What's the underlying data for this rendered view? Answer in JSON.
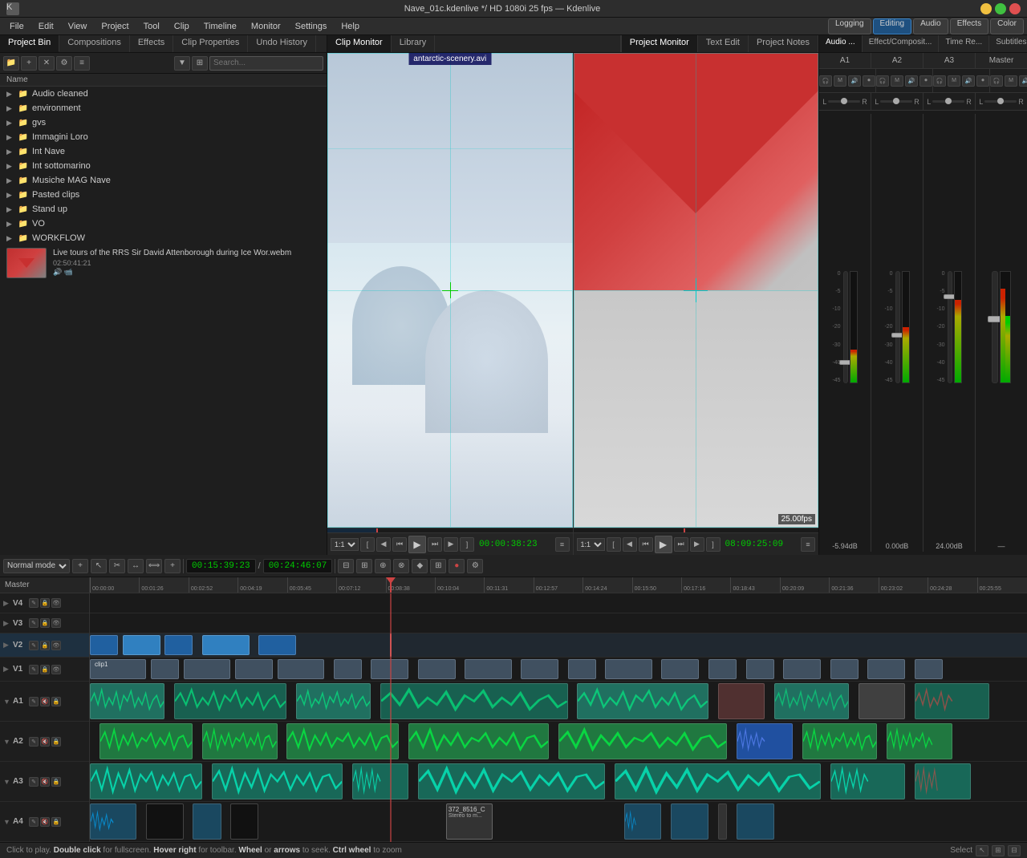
{
  "app": {
    "title": "Nave_01c.kdenlive */  HD 1080i 25 fps — Kdenlive",
    "icon": "K"
  },
  "titlebar": {
    "title": "Nave_01c.kdenlive */  HD 1080i 25 fps — Kdenlive",
    "minimize_label": "─",
    "maximize_label": "□",
    "close_label": "✕"
  },
  "menubar": {
    "items": [
      "File",
      "Edit",
      "View",
      "Project",
      "Tool",
      "Clip",
      "Timeline",
      "Monitor",
      "Settings",
      "Help"
    ]
  },
  "top_toolbar": {
    "logging_label": "Logging",
    "editing_label": "Editing",
    "audio_label": "Audio",
    "effects_label": "Effects",
    "color_label": "Color"
  },
  "left_panel": {
    "tabs": [
      "Project Bin",
      "Compositions",
      "Effects",
      "Clip Properties",
      "Undo History"
    ],
    "active_tab": "Project Bin"
  },
  "bin_toolbar": {
    "search_placeholder": "Search..."
  },
  "file_list": {
    "header": "Name",
    "items": [
      {
        "name": "Audio cleaned",
        "type": "folder",
        "expanded": false
      },
      {
        "name": "environment",
        "type": "folder",
        "expanded": false
      },
      {
        "name": "gvs",
        "type": "folder",
        "expanded": false
      },
      {
        "name": "Immagini Loro",
        "type": "folder",
        "expanded": false
      },
      {
        "name": "Int Nave",
        "type": "folder",
        "expanded": false
      },
      {
        "name": "Int sottomarino",
        "type": "folder",
        "expanded": false
      },
      {
        "name": "Musiche MAG Nave",
        "type": "folder",
        "expanded": false
      },
      {
        "name": "Pasted clips",
        "type": "folder",
        "expanded": false
      },
      {
        "name": "Stand up",
        "type": "folder",
        "expanded": false
      },
      {
        "name": "VO",
        "type": "folder",
        "expanded": false
      },
      {
        "name": "WORKFLOW",
        "type": "folder",
        "expanded": false
      },
      {
        "name": "Live tours of the RRS Sir David Attenborough during Ice Wor.webm",
        "type": "clip",
        "duration": "02:50:41:21",
        "flags": "audio,video"
      }
    ]
  },
  "clip_monitor": {
    "label": "antarctic-scenery.avi",
    "timecode": "00:00:38:23",
    "zoom_label": "1:1"
  },
  "project_monitor": {
    "timecode": "08:09:25:09",
    "fps_label": "25.00fps",
    "zoom_label": "1:1"
  },
  "right_panel": {
    "tabs": [
      "Audio ...",
      "Effect/Composit...",
      "Time Re...",
      "Subtitles"
    ],
    "active_tab": "Audio ..."
  },
  "mixer": {
    "tabs": [
      "A1",
      "A2",
      "A3",
      "Master"
    ],
    "channels": [
      {
        "label": "A1",
        "db": "-5.94dB"
      },
      {
        "label": "A2",
        "db": "0.00dB"
      },
      {
        "label": "A3",
        "db": "24.00dB"
      },
      {
        "label": "Master",
        "db": ""
      }
    ]
  },
  "timeline": {
    "mode_label": "Normal mode",
    "timecode_in": "00:15:39:23",
    "timecode_out": "00:24:46:07",
    "master_label": "Master",
    "tracks": [
      {
        "id": "V4",
        "label": "V4",
        "type": "video"
      },
      {
        "id": "V3",
        "label": "V3",
        "type": "video"
      },
      {
        "id": "V2",
        "label": "V2",
        "type": "video"
      },
      {
        "id": "V1",
        "label": "V1",
        "type": "video"
      },
      {
        "id": "A1",
        "label": "A1",
        "type": "audio"
      },
      {
        "id": "A2",
        "label": "A2",
        "type": "audio"
      },
      {
        "id": "A3",
        "label": "A3",
        "type": "audio"
      },
      {
        "id": "A4",
        "label": "A4",
        "type": "audio"
      }
    ],
    "ruler_marks": [
      "00:00:00",
      "00:01:26",
      "00:02:52",
      "00:04:19",
      "00:05:45",
      "00:07:12",
      "00:08:38",
      "00:10:04",
      "00:11:31",
      "00:12:57",
      "00:14:24",
      "00:15:50",
      "00:17:16",
      "00:18:43",
      "00:20:09",
      "00:21:36",
      "00:23:02",
      "00:24:28",
      "00:25:55"
    ]
  },
  "status_bar": {
    "help_text": "Click to play. Double click for fullscreen. Hover right for toolbar. Wheel or arrows to seek. Ctrl wheel to zoom",
    "select_label": "Select",
    "icons": [
      "select",
      "snap",
      "grid"
    ]
  },
  "tooltip": {
    "clip_name": "372_8516_C",
    "clip_info": "Stereo to m..."
  }
}
